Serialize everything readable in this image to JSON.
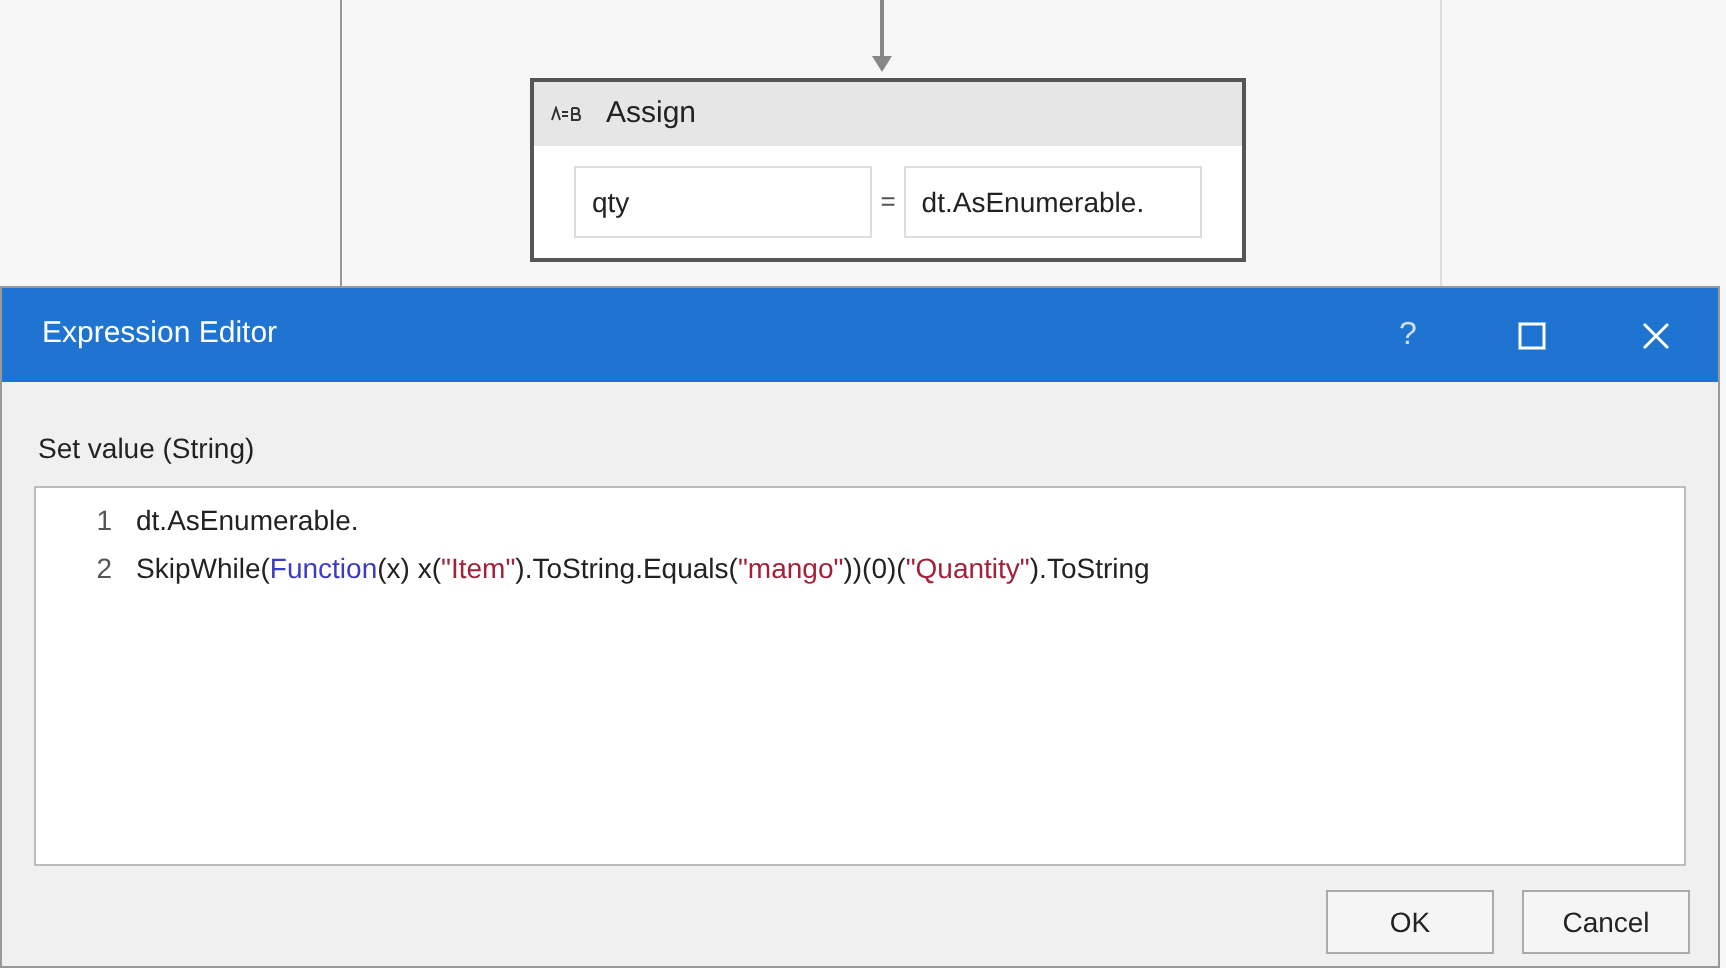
{
  "activity": {
    "title": "Assign",
    "target": "qty",
    "operator": "=",
    "value": "dt.AsEnumerable."
  },
  "dialog": {
    "title": "Expression Editor",
    "title_buttons": [
      "?"
    ],
    "label": "Set value (String)",
    "lines": [
      {
        "number": "1",
        "segments": [
          {
            "kind": "plain",
            "text": "dt.AsEnumerable."
          }
        ]
      },
      {
        "number": "2",
        "segments": [
          {
            "kind": "plain",
            "text": "SkipWhile("
          },
          {
            "kind": "keyword",
            "text": "Function"
          },
          {
            "kind": "plain",
            "text": "(x) x("
          },
          {
            "kind": "string",
            "text": "\"Item\""
          },
          {
            "kind": "plain",
            "text": ").ToString.Equals("
          },
          {
            "kind": "string",
            "text": "\"mango\""
          },
          {
            "kind": "plain",
            "text": "))(0)("
          },
          {
            "kind": "string",
            "text": "\"Quantity\""
          },
          {
            "kind": "plain",
            "text": ").ToString"
          }
        ]
      }
    ],
    "buttons": [
      "OK",
      "Cancel"
    ]
  }
}
